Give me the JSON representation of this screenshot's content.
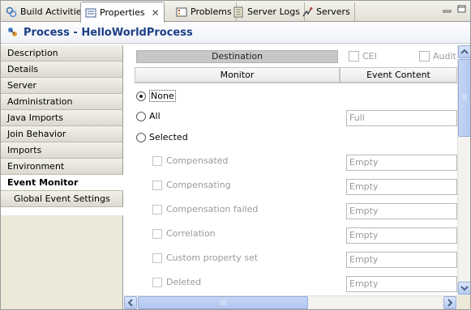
{
  "tabs": [
    {
      "label": "Build Activities",
      "icon": "build-activities-icon",
      "active": false
    },
    {
      "label": "Properties",
      "icon": "properties-icon",
      "active": true
    },
    {
      "label": "Problems",
      "icon": "problems-icon",
      "active": false
    },
    {
      "label": "Server Logs",
      "icon": "server-logs-icon",
      "active": false
    },
    {
      "label": "Servers",
      "icon": "servers-icon",
      "active": false
    }
  ],
  "title": "Process - HelloWorldProcess",
  "sidebar": {
    "items": [
      {
        "label": "Description"
      },
      {
        "label": "Details"
      },
      {
        "label": "Server"
      },
      {
        "label": "Administration"
      },
      {
        "label": "Java Imports"
      },
      {
        "label": "Join Behavior"
      },
      {
        "label": "Imports"
      },
      {
        "label": "Environment"
      },
      {
        "label": "Event Monitor",
        "selected": true
      },
      {
        "label": "Global Event Settings"
      }
    ]
  },
  "destination": {
    "header": "Destination",
    "cei_label": "CEI",
    "audit_label": "Audit"
  },
  "table": {
    "monitor_header": "Monitor",
    "event_content_header": "Event Content"
  },
  "monitor": {
    "none_label": "None",
    "all_label": "All",
    "all_value": "Full",
    "selected_label": "Selected",
    "selected_option": "None"
  },
  "events": [
    {
      "label": "Compensated",
      "value": "Empty"
    },
    {
      "label": "Compensating",
      "value": "Empty"
    },
    {
      "label": "Compensation failed",
      "value": "Empty"
    },
    {
      "label": "Correlation",
      "value": "Empty"
    },
    {
      "label": "Custom property set",
      "value": "Empty"
    },
    {
      "label": "Deleted",
      "value": "Empty"
    }
  ],
  "colors": {
    "title": "#1b3f86",
    "scroll_accent": "#b2c7f0"
  }
}
